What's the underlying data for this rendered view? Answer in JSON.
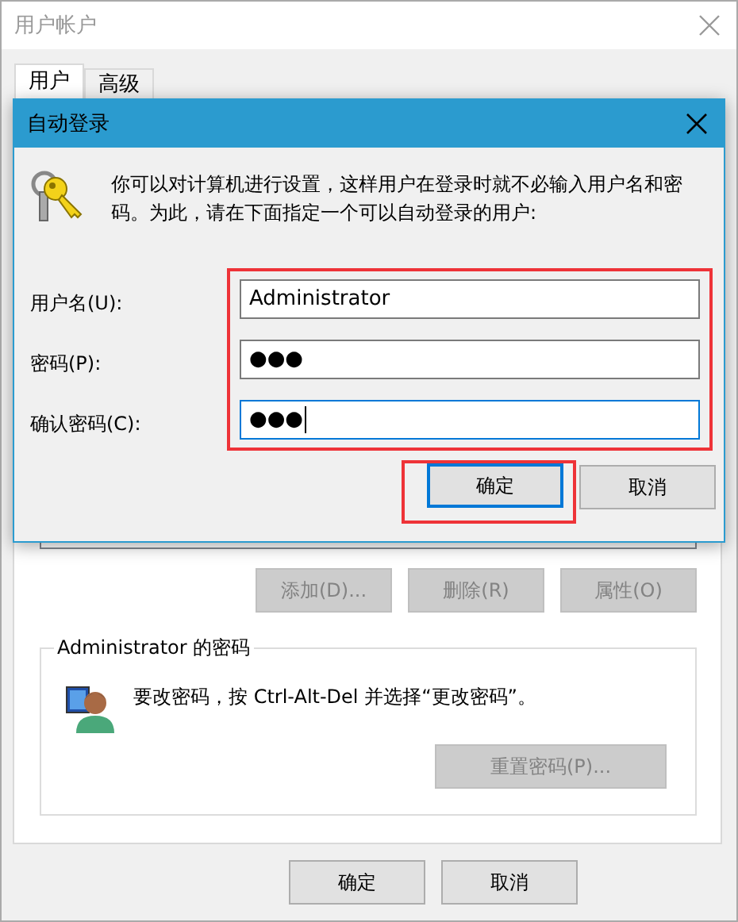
{
  "window": {
    "title": "用户帐户",
    "active": false
  },
  "tabs": [
    {
      "label": "用户",
      "selected": true
    },
    {
      "label": "高级",
      "selected": false
    }
  ],
  "user_buttons": [
    {
      "label": "添加(D)...",
      "disabled": true
    },
    {
      "label": "删除(R)",
      "disabled": true
    },
    {
      "label": "属性(O)",
      "disabled": true
    }
  ],
  "password_group": {
    "title": "Administrator 的密码",
    "text": "要改密码，按 Ctrl-Alt-Del 并选择“更改密码”。",
    "reset_button": {
      "label": "重置密码(P)...",
      "disabled": true
    }
  },
  "buttons": [
    {
      "label": "确定",
      "disabled": false
    },
    {
      "label": "取消",
      "disabled": false
    }
  ],
  "dialog": {
    "title": "自动登录",
    "description": "你可以对计算机进行设置，这样用户在登录时就不必输入用户名和密码。为此，请在下面指定一个可以自动登录的用户:",
    "fields_highlighted": true,
    "fields": [
      {
        "label": "用户名(U):",
        "value": "Administrator",
        "focused": false
      },
      {
        "label": "密码(P):",
        "value": "●●●",
        "focused": false
      },
      {
        "label": "确认密码(C):",
        "value": "●●●",
        "focused": true
      }
    ],
    "buttons": [
      {
        "label": "确定",
        "default": true,
        "highlighted": true
      },
      {
        "label": "取消",
        "default": false,
        "highlighted": false
      }
    ]
  }
}
